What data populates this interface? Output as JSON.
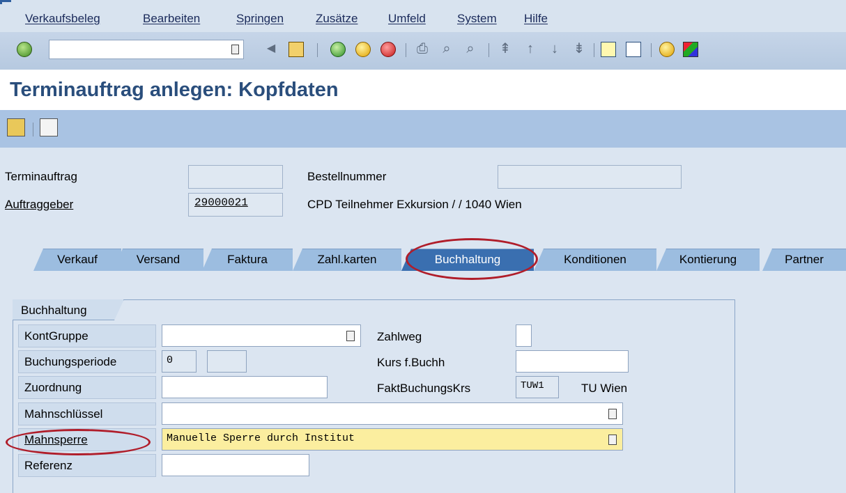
{
  "menu": [
    "Verkaufsbeleg",
    "Bearbeiten",
    "Springen",
    "Zusätze",
    "Umfeld",
    "System",
    "Hilfe"
  ],
  "toolbar": {
    "command_value": "",
    "icons": [
      "ok-icon",
      "dropdown-icon",
      "back-arrow-icon",
      "save-icon",
      "green-back-icon",
      "exit-icon",
      "cancel-icon",
      "print-icon",
      "find-icon",
      "find-next-icon",
      "first-page-icon",
      "previous-page-icon",
      "next-page-icon",
      "last-page-icon",
      "create-session-icon",
      "shortcut-icon",
      "help-icon",
      "layout-icon"
    ]
  },
  "title": "Terminauftrag anlegen: Kopfdaten",
  "app_toolbar": {
    "icons": [
      "display-partner-icon",
      "document-flow-icon"
    ]
  },
  "header": {
    "terminauftrag_label": "Terminauftrag",
    "terminauftrag_value": "",
    "bestellnummer_label": "Bestellnummer",
    "bestellnummer_value": "",
    "auftraggeber_label": "Auftraggeber",
    "auftraggeber_value": "29000021",
    "auftraggeber_desc": "CPD Teilnehmer Exkursion / / 1040 Wien"
  },
  "tabs": [
    {
      "label": "Verkauf",
      "active": false
    },
    {
      "label": "Versand",
      "active": false
    },
    {
      "label": "Faktura",
      "active": false
    },
    {
      "label": "Zahl.karten",
      "active": false
    },
    {
      "label": "Buchhaltung",
      "active": true
    },
    {
      "label": "Konditionen",
      "active": false
    },
    {
      "label": "Kontierung",
      "active": false
    },
    {
      "label": "Partner",
      "active": false
    }
  ],
  "group": {
    "title": "Buchhaltung",
    "kontgruppe_label": "KontGruppe",
    "kontgruppe_value": "",
    "buchungsperiode_label": "Buchungsperiode",
    "buchungsperiode_value": "0",
    "buchungsperiode_value2": "",
    "zuordnung_label": "Zuordnung",
    "zuordnung_value": "",
    "mahnschluessel_label": "Mahnschlüssel",
    "mahnschluessel_value": "",
    "mahnsperre_label": "Mahnsperre",
    "mahnsperre_value": "Manuelle Sperre durch Institut",
    "referenz_label": "Referenz",
    "referenz_value": "",
    "zahlweg_label": "Zahlweg",
    "zahlweg_value": "",
    "kurs_label": "Kurs f.Buchh",
    "kurs_value": "",
    "faktbuchungskrs_label": "FaktBuchungsKrs",
    "faktbuchungskrs_value": "TUW1",
    "faktbuchungskrs_desc": "TU Wien"
  },
  "colors": {
    "accent": "#2a4e7c",
    "active_tab": "#3a6fb0",
    "highlight_oval": "#b01d2a",
    "highlight_field": "#fbee9f"
  }
}
